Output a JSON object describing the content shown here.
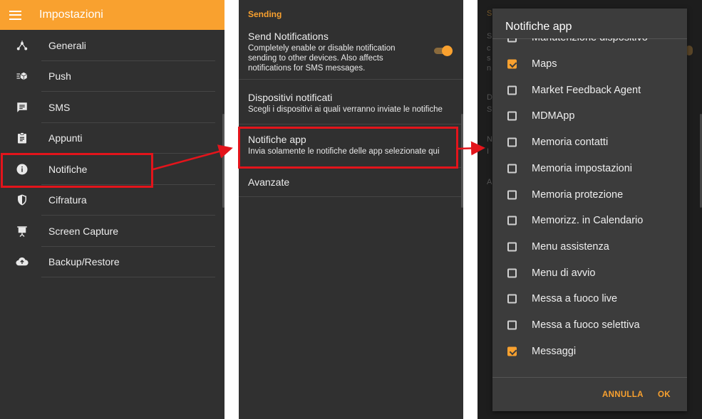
{
  "panel1": {
    "title": "Impostazioni",
    "items": [
      {
        "label": "Generali",
        "icon": "hub-icon"
      },
      {
        "label": "Push",
        "icon": "push-icon"
      },
      {
        "label": "SMS",
        "icon": "sms-icon"
      },
      {
        "label": "Appunti",
        "icon": "clipboard-icon"
      },
      {
        "label": "Notifiche",
        "icon": "info-icon"
      },
      {
        "label": "Cifratura",
        "icon": "shield-icon"
      },
      {
        "label": "Screen Capture",
        "icon": "projector-icon"
      },
      {
        "label": "Backup/Restore",
        "icon": "cloud-upload-icon"
      }
    ]
  },
  "panel2": {
    "section_header": "Sending",
    "send_notifications": {
      "title": "Send Notifications",
      "subtitle": "Completely enable or disable notification sending to other devices. Also affects notifications for SMS messages.",
      "enabled": true
    },
    "dispositivi": {
      "title": "Dispositivi notificati",
      "subtitle": "Scegli i dispositivi ai quali verranno inviate le notifiche"
    },
    "notifiche_app": {
      "title": "Notifiche app",
      "subtitle": "Invia solamente le notifiche delle app selezionate qui"
    },
    "avanzate": {
      "title": "Avanzate"
    }
  },
  "panel3": {
    "dialog_title": "Notifiche app",
    "items": [
      {
        "label": "Manutenzione dispositivo",
        "checked": false
      },
      {
        "label": "Maps",
        "checked": true
      },
      {
        "label": "Market Feedback Agent",
        "checked": false
      },
      {
        "label": "MDMApp",
        "checked": false
      },
      {
        "label": "Memoria contatti",
        "checked": false
      },
      {
        "label": "Memoria impostazioni",
        "checked": false
      },
      {
        "label": "Memoria protezione",
        "checked": false
      },
      {
        "label": "Memorizz. in Calendario",
        "checked": false
      },
      {
        "label": "Menu assistenza",
        "checked": false
      },
      {
        "label": "Menu di avvio",
        "checked": false
      },
      {
        "label": "Messa a fuoco live",
        "checked": false
      },
      {
        "label": "Messa a fuoco selettiva",
        "checked": false
      },
      {
        "label": "Messaggi",
        "checked": true
      }
    ],
    "cancel_label": "ANNULLA",
    "ok_label": "OK"
  },
  "colors": {
    "accent": "#f9a12f",
    "background": "#303030",
    "highlight": "#e3141b"
  }
}
